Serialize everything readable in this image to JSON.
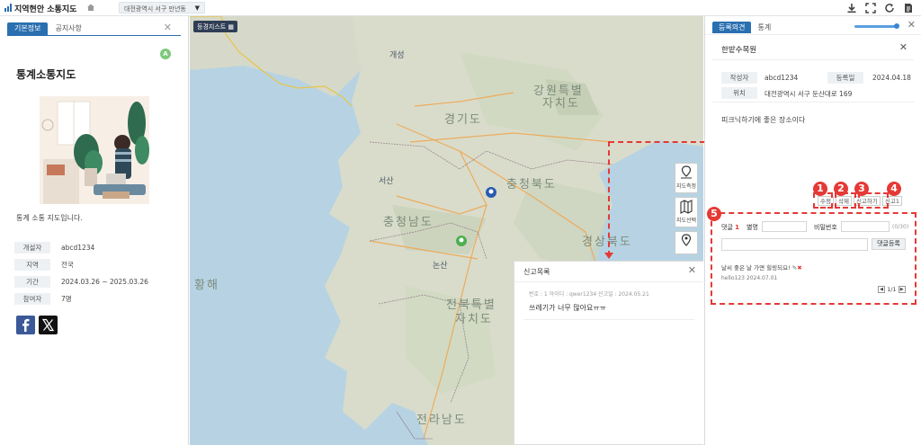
{
  "header": {
    "app_title": "지역현안 소통지도",
    "address": "대전광역시 서구 만년동",
    "tools": [
      "download-icon",
      "fullscreen-icon",
      "refresh-icon",
      "document-icon"
    ]
  },
  "left_panel": {
    "tabs": [
      "기본정보",
      "공지사항"
    ],
    "badge": "A",
    "map_title": "통계소통지도",
    "description": "통계 소통 지도입니다.",
    "info": [
      {
        "label": "개설자",
        "value": "abcd1234"
      },
      {
        "label": "지역",
        "value": "전국"
      },
      {
        "label": "기간",
        "value": "2024.03.26 ~ 2025.03.26"
      },
      {
        "label": "참여자",
        "value": "7명"
      }
    ],
    "social": [
      "facebook-icon",
      "x-icon"
    ]
  },
  "map": {
    "basemap_label": "등경지스트",
    "tools": [
      "지도측정",
      "지도선택",
      "위치"
    ],
    "places": [
      {
        "name": "개성"
      },
      {
        "name": "강원특별"
      },
      {
        "name": "자치도"
      },
      {
        "name": "경기도"
      },
      {
        "name": "충청북도"
      },
      {
        "name": "충청남도"
      },
      {
        "name": "전북특별"
      },
      {
        "name": "자치도"
      },
      {
        "name": "전라남도"
      },
      {
        "name": "황해"
      },
      {
        "name": "경상북도"
      },
      {
        "name": "서산"
      },
      {
        "name": "논산"
      }
    ],
    "report": {
      "title": "신고목록",
      "meta": "번호 : 1     아이디 : qwer1234     신고일 : 2024.05.21",
      "text": "쓰레기가 너무 많아요ㅠㅠ"
    }
  },
  "right_panel": {
    "tabs": [
      "등록의견",
      "통계"
    ],
    "place_title": "한밭수목원",
    "author_label": "작성자",
    "author": "abcd1234",
    "date_label": "등록일",
    "date": "2024.04.18",
    "location_label": "위치",
    "location": "대전광역시 서구 둔산대로 169",
    "opinion": "피크닉하기에 좋은 장소이다",
    "actions": [
      "수정",
      "삭제",
      "신고하기",
      "신고1"
    ],
    "markers": [
      "1",
      "2",
      "3",
      "4",
      "5"
    ],
    "comments": {
      "label": "댓글",
      "count": "1",
      "nickname_label": "별명",
      "password_label": "비밀번호",
      "char_count": "(0/30)",
      "submit": "댓글등록",
      "items": [
        {
          "text": "날씨 좋은 날 가면 힐링되요!",
          "author": "hello123",
          "date": "2024.07.01"
        }
      ],
      "page": "1/1"
    }
  }
}
